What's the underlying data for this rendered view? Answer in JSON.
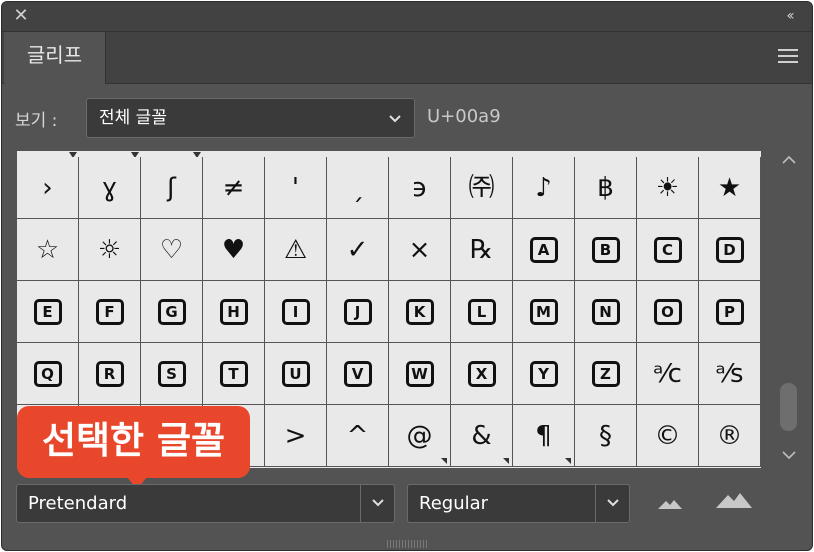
{
  "window": {
    "close_glyph": "✕",
    "collapse_glyph": "‹‹"
  },
  "tabs": [
    {
      "label": "글리프",
      "active": true
    }
  ],
  "view": {
    "label": "보기 :",
    "selected": "전체 글꼴",
    "unicode": "U+00a9"
  },
  "glyph_rows": [
    [
      "›",
      "ɣ",
      "ʃ",
      "≠",
      "'",
      "ˏ",
      "϶",
      "㈜",
      "♪",
      "฿",
      "☀",
      "★"
    ],
    [
      "☆",
      "☼",
      "♡",
      "♥",
      "⚠",
      "✓",
      "×",
      "℞",
      "A",
      "B",
      "C",
      "D"
    ],
    [
      "E",
      "F",
      "G",
      "H",
      "I",
      "J",
      "K",
      "L",
      "M",
      "N",
      "O",
      "P"
    ],
    [
      "Q",
      "R",
      "S",
      "T",
      "U",
      "V",
      "W",
      "X",
      "Y",
      "Z",
      "ᵃ⁄c",
      "ᵃ⁄s"
    ],
    [
      "",
      "",
      "",
      "",
      ">",
      "^",
      "@",
      "&",
      "¶",
      "§",
      "©",
      "®"
    ]
  ],
  "callout": {
    "text": "선택한 글꼴",
    "color": "#e8472b"
  },
  "font": {
    "family": "Pretendard",
    "style": "Regular"
  },
  "icons": {
    "close": "close-icon",
    "collapse": "collapse-icon",
    "menu": "panel-menu-icon",
    "zoom_out": "mountain-small-icon",
    "zoom_in": "mountain-large-icon"
  }
}
